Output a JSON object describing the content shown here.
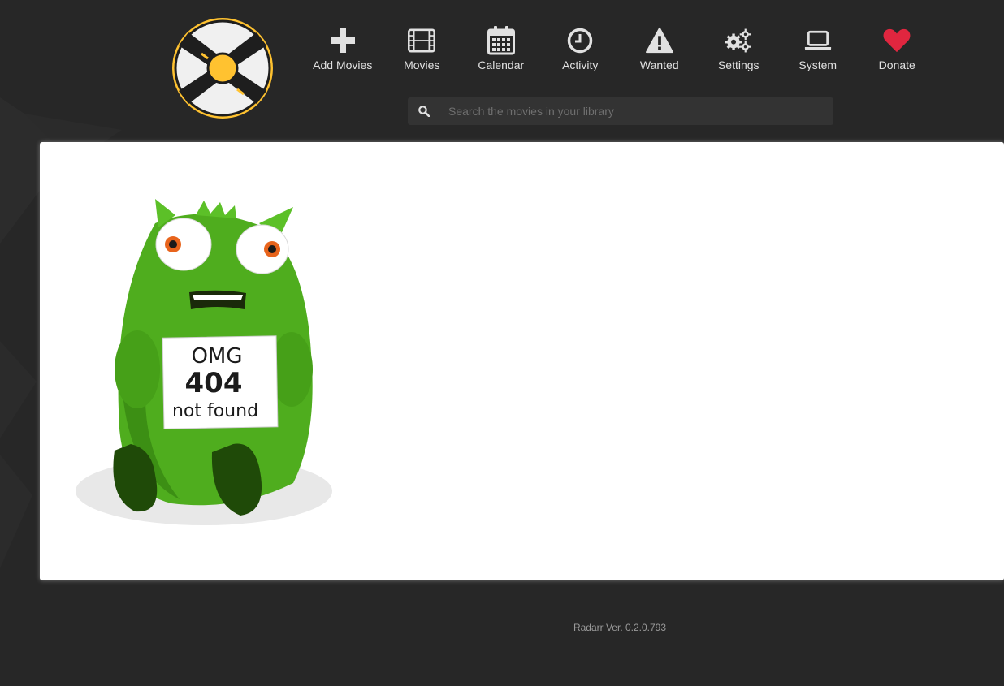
{
  "app": {
    "name": "Radarr"
  },
  "nav": {
    "items": [
      {
        "label": "Add Movies",
        "icon": "plus-icon"
      },
      {
        "label": "Movies",
        "icon": "film-icon"
      },
      {
        "label": "Calendar",
        "icon": "calendar-icon"
      },
      {
        "label": "Activity",
        "icon": "clock-icon"
      },
      {
        "label": "Wanted",
        "icon": "warning-icon"
      },
      {
        "label": "Settings",
        "icon": "gears-icon"
      },
      {
        "label": "System",
        "icon": "laptop-icon"
      },
      {
        "label": "Donate",
        "icon": "heart-icon"
      }
    ]
  },
  "search": {
    "placeholder": "Search the movies in your library"
  },
  "error": {
    "line1": "OMG",
    "line2": "404",
    "line3": "not found"
  },
  "footer": {
    "version": "Radarr Ver. 0.2.0.793"
  },
  "colors": {
    "background": "#272727",
    "accent": "#ffc230",
    "donate": "#e0263f",
    "monster": "#4fad1e"
  }
}
